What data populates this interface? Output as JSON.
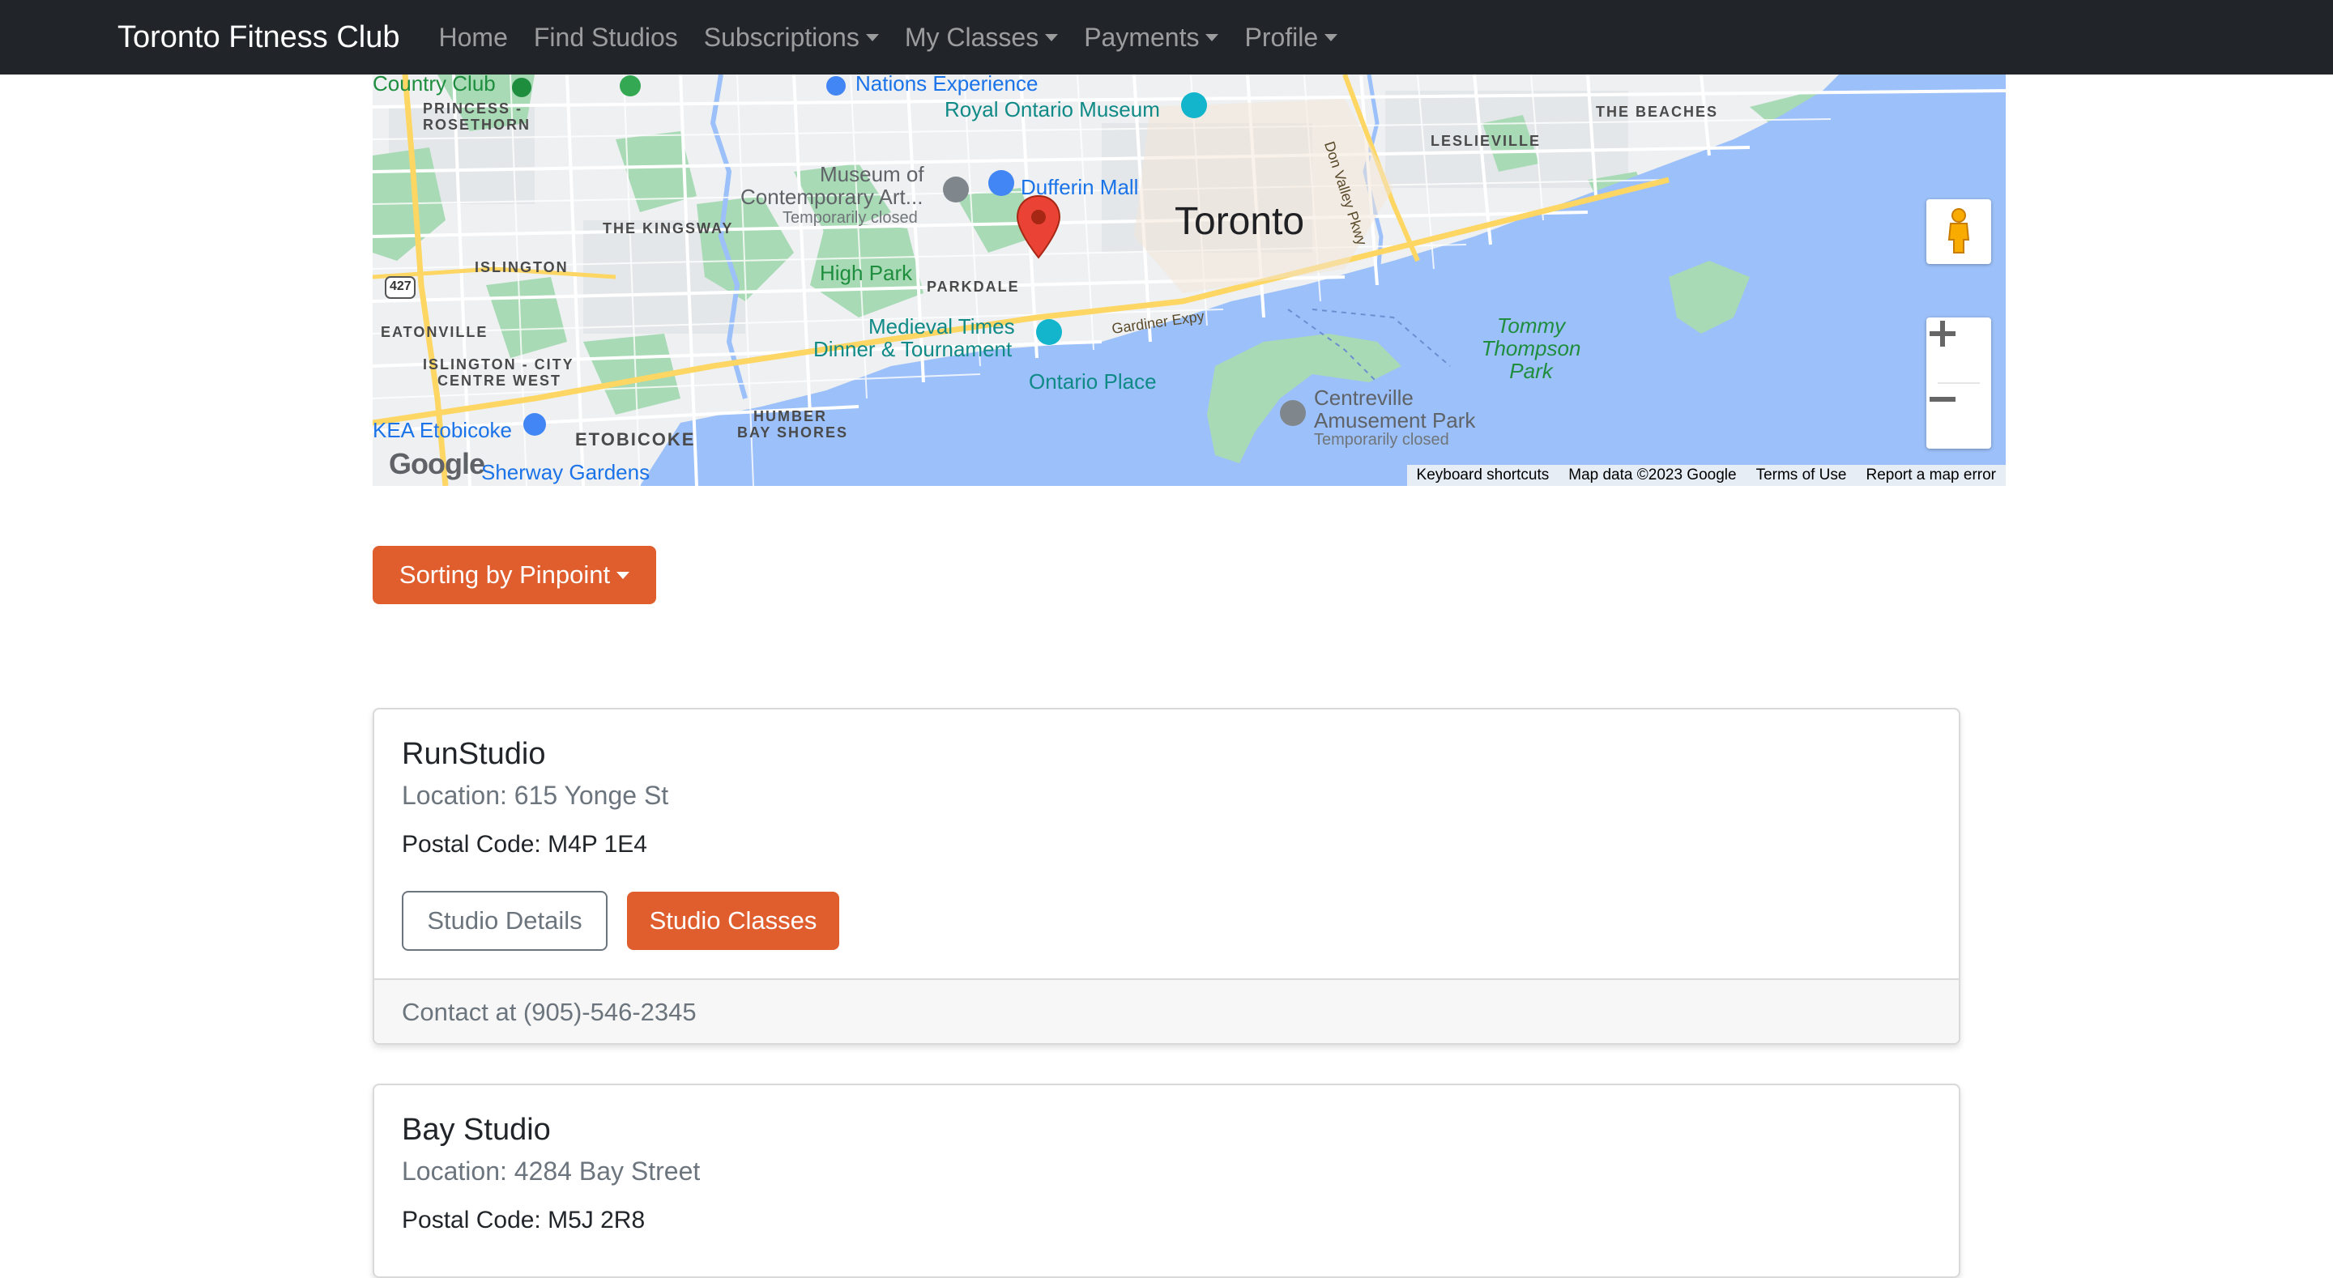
{
  "navbar": {
    "brand": "Toronto Fitness Club",
    "items": [
      {
        "label": "Home",
        "dropdown": false
      },
      {
        "label": "Find Studios",
        "dropdown": false
      },
      {
        "label": "Subscriptions",
        "dropdown": true
      },
      {
        "label": "My Classes",
        "dropdown": true
      },
      {
        "label": "Payments",
        "dropdown": true
      },
      {
        "label": "Profile",
        "dropdown": true
      }
    ]
  },
  "map": {
    "city": "Toronto",
    "labels": {
      "country_club": "Country Club",
      "nations_experience": "Nations Experience",
      "royal_ontario_museum": "Royal Ontario Museum",
      "princess_rosethorn_1": "PRINCESS -",
      "princess_rosethorn_2": "ROSETHORN",
      "museum_1": "Museum of",
      "museum_2": "Contemporary Art...",
      "temporarily_closed_1": "Temporarily closed",
      "dufferin_mall": "Dufferin Mall",
      "the_kingsway": "THE KINGSWAY",
      "islington": "ISLINGTON",
      "high_park": "High Park",
      "parkdale": "PARKDALE",
      "eatonville": "EATONVILLE",
      "islington_city_1": "ISLINGTON - CITY",
      "islington_city_2": "CENTRE WEST",
      "medieval_1": "Medieval Times",
      "medieval_2": "Dinner & Tournament",
      "gardiner": "Gardiner Expy",
      "ontario_place": "Ontario Place",
      "humber_1": "HUMBER",
      "humber_2": "BAY SHORES",
      "ikea": "KEA Etobicoke",
      "etobicoke": "ETOBICOKE",
      "sherway": "Sherway Gardens",
      "centreville_1": "Centreville",
      "centreville_2": "Amusement Park",
      "temporarily_closed_2": "Temporarily closed",
      "the_beaches": "THE BEACHES",
      "leslieville": "LESLIEVILLE",
      "don_valley": "Don Valley Pkwy",
      "tommy_1": "Tommy",
      "tommy_2": "Thompson",
      "tommy_3": "Park",
      "hwy_427": "427"
    },
    "logo": "Google",
    "attribution": {
      "keyboard": "Keyboard shortcuts",
      "data": "Map data ©2023 Google",
      "terms": "Terms of Use",
      "report": "Report a map error"
    }
  },
  "sort_button": {
    "label": "Sorting by Pinpoint"
  },
  "studios": [
    {
      "name": "RunStudio",
      "location": "Location: 615 Yonge St",
      "postal": "Postal Code: M4P 1E4",
      "details_label": "Studio Details",
      "classes_label": "Studio Classes",
      "contact": "Contact at (905)-546-2345"
    },
    {
      "name": "Bay Studio",
      "location": "Location: 4284 Bay Street",
      "postal": "Postal Code: M5J 2R8"
    }
  ],
  "colors": {
    "navbar_bg": "#212529",
    "accent": "#e05d2e",
    "water": "#9cc0f9",
    "park": "#a8dab5",
    "pin": "#ea4335"
  }
}
